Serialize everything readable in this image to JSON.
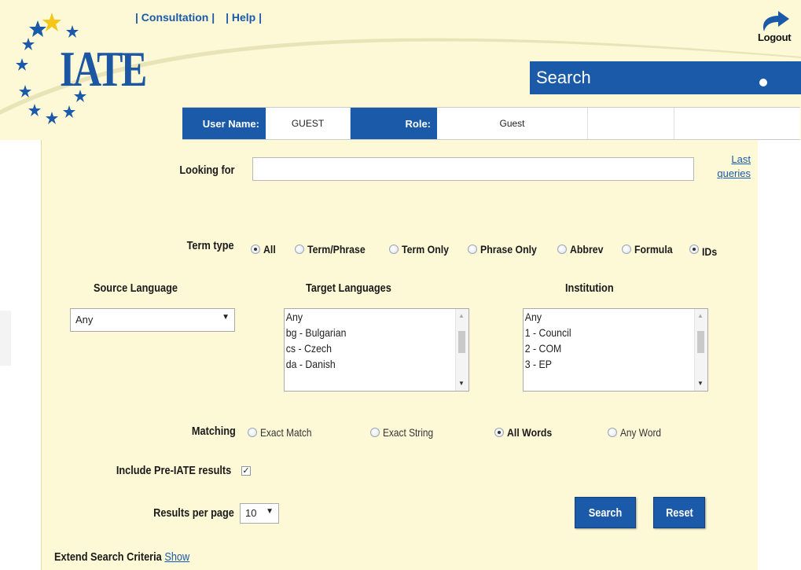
{
  "nav": {
    "consultation": "| Consultation |",
    "help": "| Help |",
    "logout": "Logout"
  },
  "logo": {
    "text": "IATE"
  },
  "banner": {
    "title": "Search"
  },
  "user": {
    "name_label": "User Name:",
    "name_value": "GUEST",
    "role_label": "Role:",
    "role_value": "Guest"
  },
  "form": {
    "looking_for_label": "Looking for",
    "looking_for_value": "",
    "last_queries_line1": "Last",
    "last_queries_line2": "queries",
    "term_type_label": "Term type",
    "term_types": [
      {
        "label": "All",
        "selected": true
      },
      {
        "label": "Term/Phrase",
        "selected": false
      },
      {
        "label": "Term Only",
        "selected": false
      },
      {
        "label": "Phrase Only",
        "selected": false
      },
      {
        "label": "Abbrev",
        "selected": false
      },
      {
        "label": "Formula",
        "selected": false
      },
      {
        "label": "IDs",
        "selected": true
      }
    ],
    "source_language_label": "Source Language",
    "source_language_value": "Any",
    "target_languages_label": "Target Languages",
    "target_languages": [
      "Any",
      "bg - Bulgarian",
      "cs - Czech",
      "da - Danish"
    ],
    "institution_label": "Institution",
    "institutions": [
      "Any",
      "1 - Council",
      "2 - COM",
      "3 - EP"
    ],
    "matching_label": "Matching",
    "matching_options": [
      {
        "label": "Exact Match",
        "selected": false
      },
      {
        "label": "Exact String",
        "selected": false
      },
      {
        "label": "All Words",
        "selected": true
      },
      {
        "label": "Any Word",
        "selected": false
      }
    ],
    "pre_iate_label": "Include Pre-IATE results",
    "pre_iate_checked": true,
    "results_per_page_label": "Results per page",
    "results_per_page_value": "10",
    "search_button": "Search",
    "reset_button": "Reset",
    "extend_label": "Extend Search Criteria",
    "extend_link": "Show"
  },
  "colors": {
    "brand_blue": "#1b5aa8",
    "panel_bg": "#fdf9d7",
    "star_yellow": "#f5c518"
  }
}
